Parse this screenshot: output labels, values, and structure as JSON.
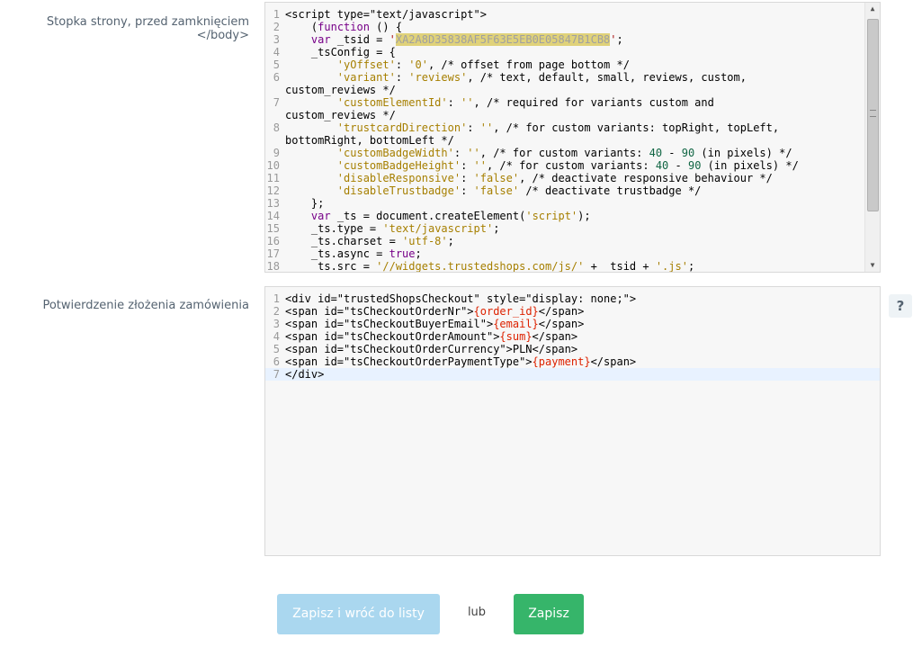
{
  "labels": {
    "footer": "Stopka strony, przed zamknięciem </body>",
    "confirmation": "Potwierdzenie złożenia zamówienia"
  },
  "editor_footer": {
    "lines": [
      {
        "n": "1",
        "text": "<script type=\"text/javascript\">"
      },
      {
        "n": "2",
        "text": "    (function () {"
      },
      {
        "n": "3",
        "text": "    var _tsid = 'XA2A8D35838AF5F63E5EB0E05847B1CB8';"
      },
      {
        "n": "4",
        "text": "    _tsConfig = {"
      },
      {
        "n": "5",
        "text": "        'yOffset': '0', /* offset from page bottom */"
      },
      {
        "n": "6",
        "text": "        'variant': 'reviews', /* text, default, small, reviews, custom,"
      },
      {
        "n": "",
        "text": "custom_reviews */"
      },
      {
        "n": "7",
        "text": "        'customElementId': '', /* required for variants custom and"
      },
      {
        "n": "",
        "text": "custom_reviews */"
      },
      {
        "n": "8",
        "text": "        'trustcardDirection': '', /* for custom variants: topRight, topLeft,"
      },
      {
        "n": "",
        "text": "bottomRight, bottomLeft */"
      },
      {
        "n": "9",
        "text": "        'customBadgeWidth': '', /* for custom variants: 40 - 90 (in pixels) */"
      },
      {
        "n": "10",
        "text": "        'customBadgeHeight': '', /* for custom variants: 40 - 90 (in pixels) */"
      },
      {
        "n": "11",
        "text": "        'disableResponsive': 'false', /* deactivate responsive behaviour */"
      },
      {
        "n": "12",
        "text": "        'disableTrustbadge': 'false' /* deactivate trustbadge */"
      },
      {
        "n": "13",
        "text": "    };"
      },
      {
        "n": "14",
        "text": "    var _ts = document.createElement('script');"
      },
      {
        "n": "15",
        "text": "    _ts.type = 'text/javascript';"
      },
      {
        "n": "16",
        "text": "    _ts.charset = 'utf-8';"
      },
      {
        "n": "17",
        "text": "    _ts.async = true;"
      },
      {
        "n": "18",
        "text": "    _ts.src = '//widgets.trustedshops.com/js/' + _tsid + '.js';"
      }
    ]
  },
  "editor_confirmation": {
    "lines": [
      {
        "n": "1",
        "text": "<div id=\"trustedShopsCheckout\" style=\"display: none;\">"
      },
      {
        "n": "2",
        "text": "<span id=\"tsCheckoutOrderNr\">{order_id}</span>"
      },
      {
        "n": "3",
        "text": "<span id=\"tsCheckoutBuyerEmail\">{email}</span>"
      },
      {
        "n": "4",
        "text": "<span id=\"tsCheckoutOrderAmount\">{sum}</span>"
      },
      {
        "n": "5",
        "text": "<span id=\"tsCheckoutOrderCurrency\">PLN</span>"
      },
      {
        "n": "6",
        "text": "<span id=\"tsCheckoutOrderPaymentType\">{payment}</span>"
      },
      {
        "n": "7",
        "text": "</div>"
      }
    ]
  },
  "help": {
    "label": "?"
  },
  "buttons": {
    "save_and_back": "Zapisz i wróć do listy",
    "or": "lub",
    "save": "Zapisz"
  },
  "colors": {
    "save_back_bg": "#aad7ef",
    "save_bg": "#36b56a"
  },
  "icons": {
    "scroll_up": "triangle-up-icon",
    "scroll_down": "triangle-down-icon",
    "help": "question-mark-icon"
  }
}
